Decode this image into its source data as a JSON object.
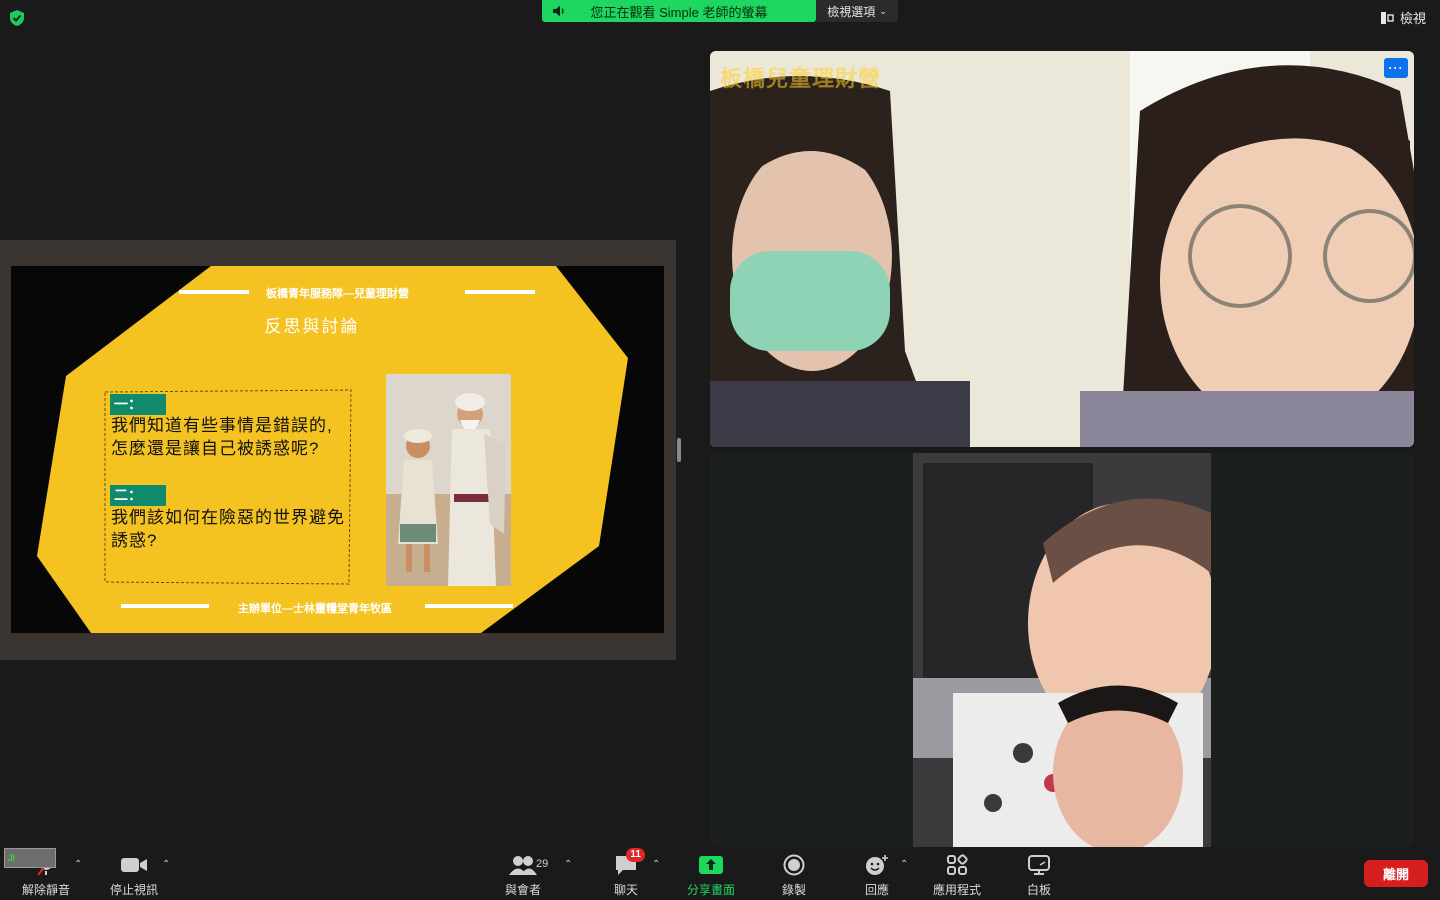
{
  "top": {
    "banner_text": "您正在觀看 Simple 老師的螢幕",
    "view_options_label": "檢視選項",
    "view_label": "檢視"
  },
  "slide": {
    "title": "板橋青年服務隊—兒童理財營",
    "heading": "反思與討論",
    "q1_label": "一：",
    "q1_text": "我們知道有些事情是錯誤的,怎麼還是讓自己被誘惑呢?",
    "q2_label": "二：",
    "q2_text": "我們該如何在險惡的世界避免誘惑?",
    "footer": "主辦單位—士林靈糧堂青年牧區"
  },
  "tiles": {
    "watermark": "板橋兒童理財營",
    "more_label": "···"
  },
  "self_view": {
    "label": "JI"
  },
  "toolbar": {
    "unmute": "解除靜音",
    "stop_video": "停止視訊",
    "participants": "與會者",
    "participants_count": "29",
    "chat": "聊天",
    "chat_badge": "11",
    "share": "分享畫面",
    "record": "錄製",
    "reactions": "回應",
    "apps": "應用程式",
    "whiteboard": "白板",
    "leave": "離開"
  },
  "colors": {
    "share_green": "#1ed760",
    "leave_red": "#d71e1e",
    "slide_yellow": "#f4c321",
    "label_teal": "#0f8a6a"
  }
}
